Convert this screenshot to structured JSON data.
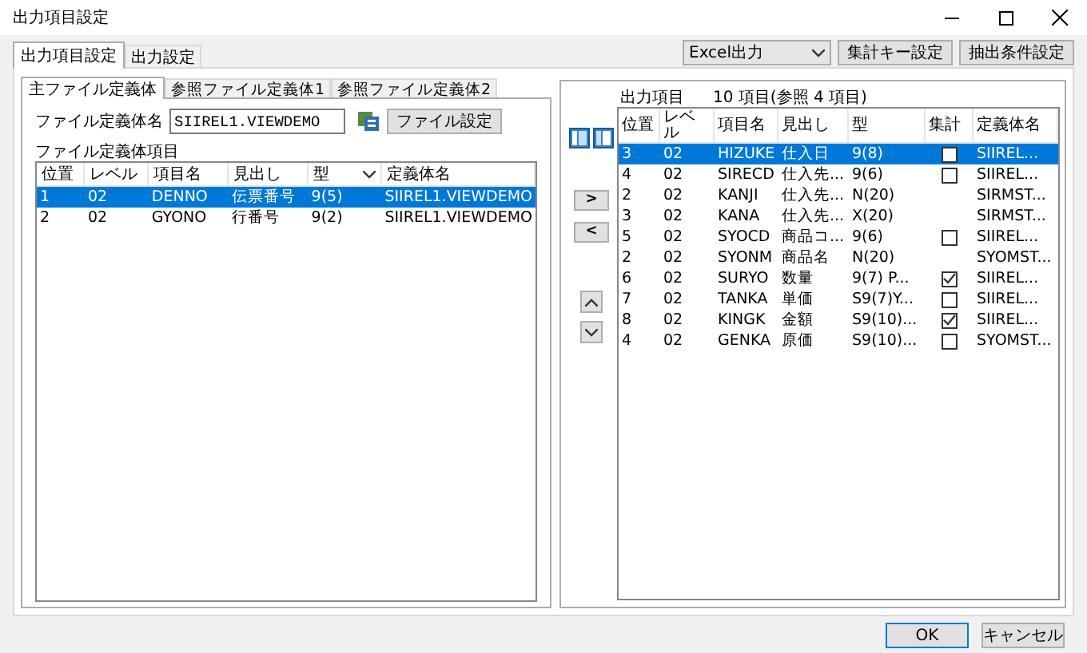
{
  "window": {
    "title": "出力項目設定"
  },
  "tabs": [
    {
      "label": "出力項目設定",
      "selected": true
    },
    {
      "label": "出力設定",
      "selected": false
    }
  ],
  "toolbar": {
    "output_select": {
      "value": "Excel出力"
    },
    "buttons": [
      "集計キー設定",
      "抽出条件設定"
    ]
  },
  "left_panel": {
    "tabs": [
      {
        "label": "主ファイル定義体",
        "selected": true
      },
      {
        "label": "参照ファイル定義体1",
        "selected": false
      },
      {
        "label": "参照ファイル定義体2",
        "selected": false
      }
    ],
    "file_label": "ファイル定義体名",
    "file_field": {
      "value": "SIIREL1.VIEWDEMO"
    },
    "file_button": "ファイル設定",
    "items_label": "ファイル定義体項目",
    "table": {
      "columns": [
        "位置",
        "レベル",
        "項目名",
        "見出し",
        "型",
        "定義体名"
      ],
      "rows": [
        {
          "cells": [
            "1",
            "02",
            "DENNO",
            "伝票番号",
            "9(5)",
            "SIIREL1.VIEWDEMO"
          ],
          "selected": true
        },
        {
          "cells": [
            "2",
            "02",
            "GYONO",
            "行番号",
            "9(2)",
            "SIIREL1.VIEWDEMO"
          ],
          "selected": false
        }
      ]
    }
  },
  "move_buttons": [
    ">",
    "<"
  ],
  "right_panel": {
    "label": "出力項目",
    "count": "10 項目(参照 4 項目)",
    "table": {
      "columns": [
        "位置",
        "レベル",
        "項目名",
        "見出し",
        "型",
        "集計",
        "定義体名"
      ],
      "rows": [
        {
          "cells": [
            "3",
            "02",
            "HIZUKE",
            "仕入日",
            "9(8)",
            "SIIREL..."
          ],
          "kind": "checkbox",
          "checked": false,
          "selected": true
        },
        {
          "cells": [
            "4",
            "02",
            "SIRECD",
            "仕入先...",
            "9(6)",
            "SIIREL..."
          ],
          "kind": "checkbox",
          "checked": false,
          "selected": false
        },
        {
          "cells": [
            "2",
            "02",
            "KANJI",
            "仕入先...",
            "N(20)",
            "SIRMST..."
          ],
          "kind": "plain",
          "selected": false
        },
        {
          "cells": [
            "3",
            "02",
            "KANA",
            "仕入先...",
            "X(20)",
            "SIRMST..."
          ],
          "kind": "plain",
          "selected": false
        },
        {
          "cells": [
            "5",
            "02",
            "SYOCD",
            "商品コ...",
            "9(6)",
            "SIIREL..."
          ],
          "kind": "checkbox",
          "checked": false,
          "selected": false
        },
        {
          "cells": [
            "2",
            "02",
            "SYONM",
            "商品名",
            "N(20)",
            "SYOMST..."
          ],
          "kind": "plain",
          "selected": false
        },
        {
          "cells": [
            "6",
            "02",
            "SURYO",
            "数量",
            "9(7) P...",
            "SIIREL..."
          ],
          "kind": "checkbox",
          "checked": true,
          "selected": false
        },
        {
          "cells": [
            "7",
            "02",
            "TANKA",
            "単価",
            "S9(7)Y...",
            "SIIREL..."
          ],
          "kind": "checkbox",
          "checked": false,
          "selected": false
        },
        {
          "cells": [
            "8",
            "02",
            "KINGK",
            "金額",
            "S9(10)...",
            "SIIREL..."
          ],
          "kind": "checkbox",
          "checked": true,
          "selected": false
        },
        {
          "cells": [
            "4",
            "02",
            "GENKA",
            "原価",
            "S9(10)...",
            "SYOMST..."
          ],
          "kind": "checkbox",
          "checked": false,
          "selected": false
        }
      ]
    }
  },
  "buttons": [
    "OK",
    "キャンセル"
  ]
}
